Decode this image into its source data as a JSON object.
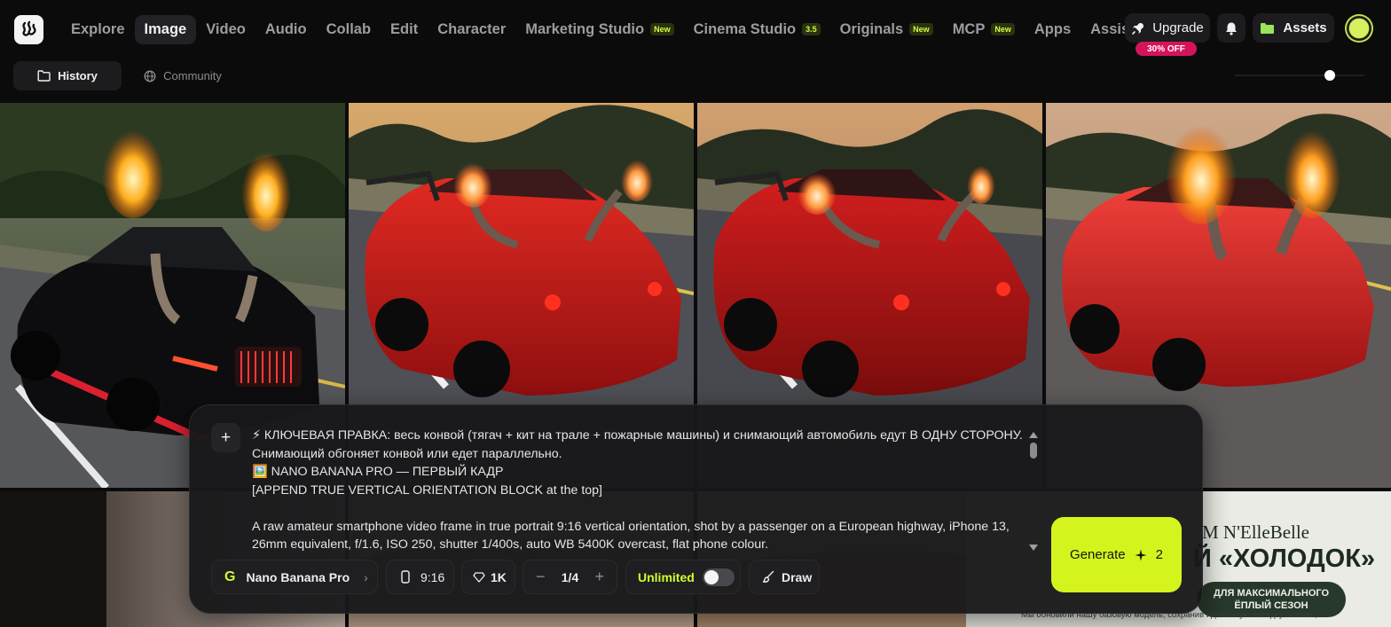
{
  "nav": {
    "items": [
      {
        "label": "Explore"
      },
      {
        "label": "Image",
        "active": true
      },
      {
        "label": "Video"
      },
      {
        "label": "Audio"
      },
      {
        "label": "Collab"
      },
      {
        "label": "Edit"
      },
      {
        "label": "Character"
      },
      {
        "label": "Marketing Studio",
        "badge": "New"
      },
      {
        "label": "Cinema Studio",
        "badge": "3.5"
      },
      {
        "label": "Originals",
        "badge": "New"
      },
      {
        "label": "MCP",
        "badge": "New"
      },
      {
        "label": "Apps"
      },
      {
        "label": "Assist"
      }
    ],
    "upgrade_label": "Upgrade",
    "discount_badge": "30% OFF",
    "assets_label": "Assets"
  },
  "subbar": {
    "history_label": "History",
    "community_label": "Community",
    "zoom_level": 0.73
  },
  "gallery": {
    "items": [
      {
        "subject": "black luxury car with flaming exhaust stacks on highway"
      },
      {
        "subject": "red sports car with flaming exhaust stacks on highway"
      },
      {
        "subject": "red sports car with flaming exhaust stacks on highway"
      },
      {
        "subject": "red sports car with flaming exhaust stacks on highway"
      }
    ],
    "ad_text": {
      "line1": "М N'ElleBelle",
      "line2": "Й «ХОЛОДОК»",
      "pill": "ДЛЯ МАКСИМАЛЬНОГО ЁПЛЫЙ СЕЗОН",
      "footnote": "Мы обновили нашу базовую модель, сохранив идеальную посадку и стиль,"
    }
  },
  "prompt": {
    "lines": [
      "⚡ КЛЮЧЕВАЯ ПРАВКА: весь конвой (тягач + кит на трале + пожарные машины) и снимающий автомобиль едут В ОДНУ СТОРОНУ.",
      "Снимающий обгоняет конвой или едет параллельно.",
      "🖼️ NANO BANANA PRO — ПЕРВЫЙ КАДР",
      "[APPEND TRUE VERTICAL ORIENTATION BLOCK at the top]",
      "",
      "A raw amateur smartphone video frame in true portrait 9:16 vertical orientation, shot by a passenger on a European highway, iPhone 13,",
      "26mm equivalent, f/1.6, ISO 250, shutter 1/400s, auto WB 5400K overcast, flat phone colour."
    ]
  },
  "controls": {
    "model": "Nano Banana Pro",
    "model_icon": "G",
    "aspect_ratio": "9:16",
    "quality": "1K",
    "count_minus": "−",
    "count": "1/4",
    "count_plus": "+",
    "unlimited_label": "Unlimited",
    "unlimited_on": false,
    "draw_label": "Draw",
    "generate_label": "Generate",
    "generate_cost": "2"
  },
  "colors": {
    "accent": "#d5f31d",
    "badge_pink": "#d4145a",
    "background": "#0b0b0c"
  }
}
